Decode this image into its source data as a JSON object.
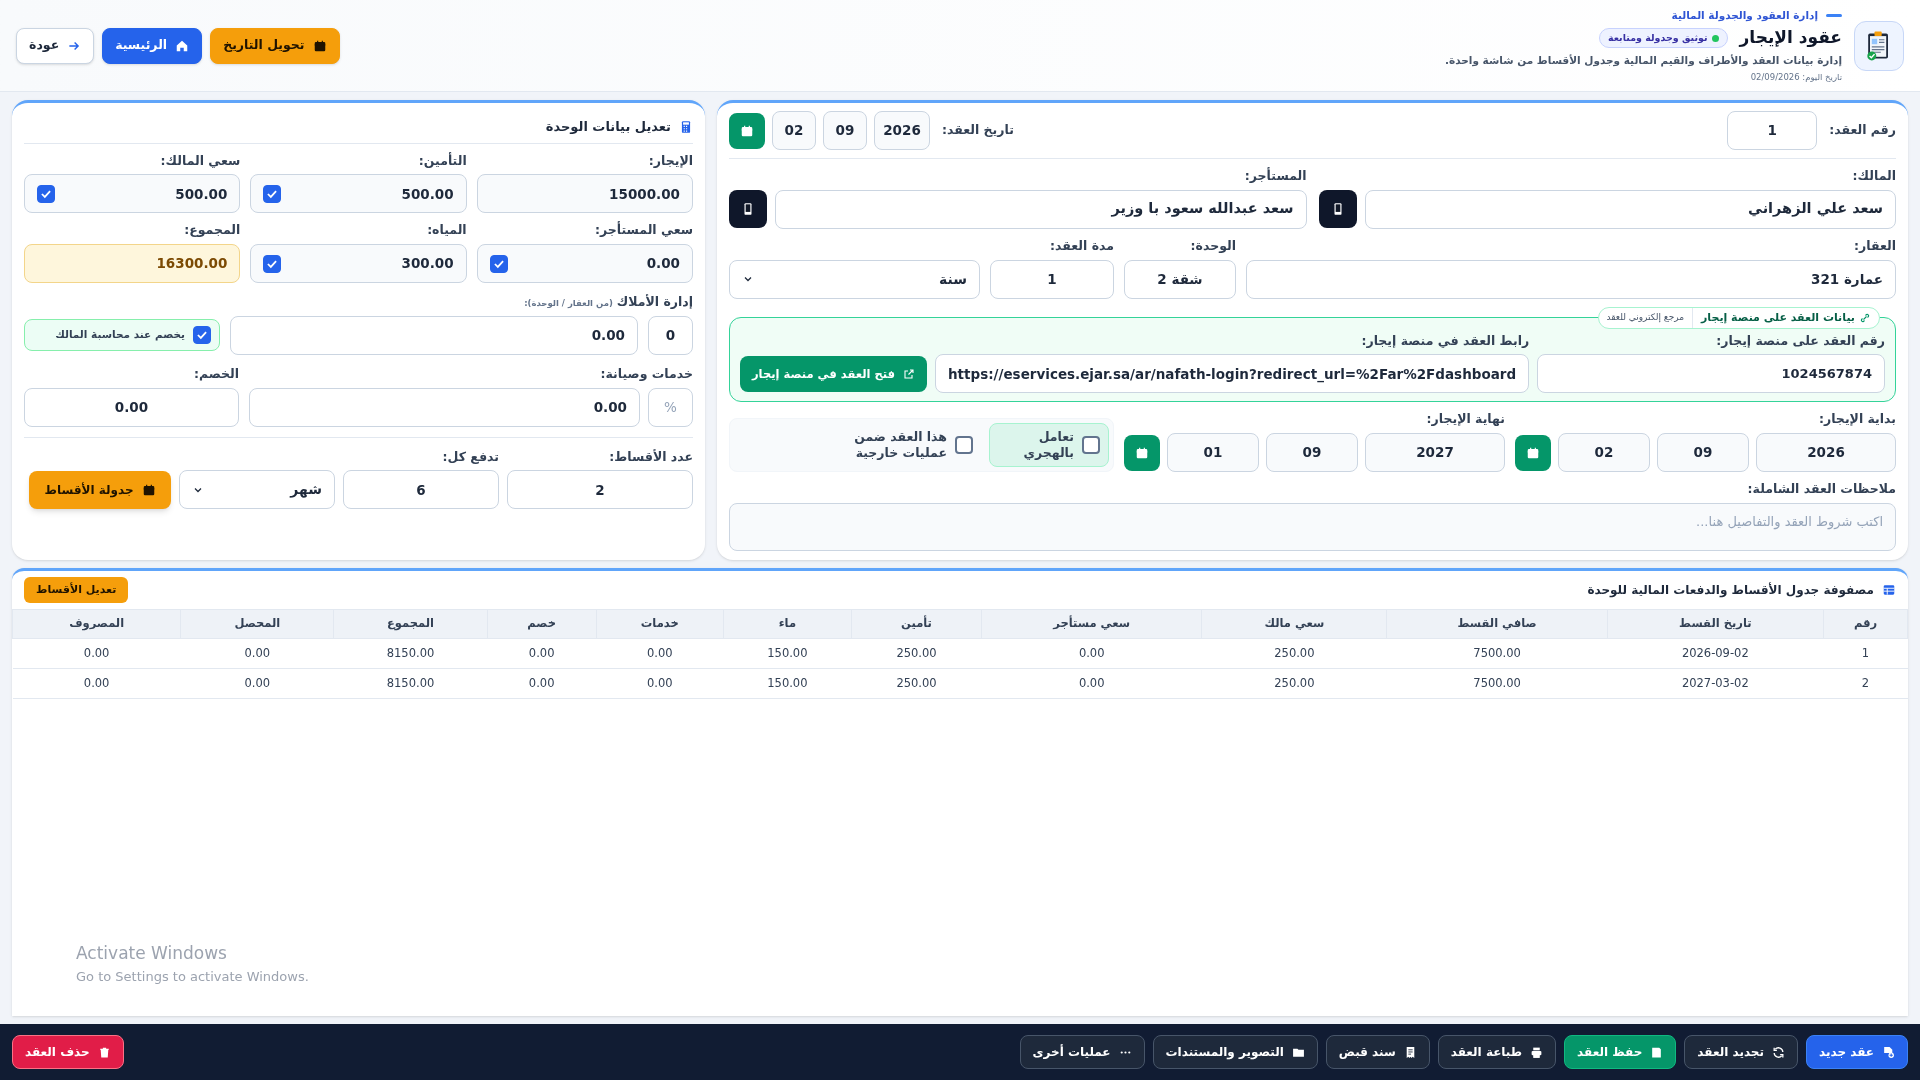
{
  "header": {
    "breadcrumb": "إدارة العقود والجدولة المالية",
    "title": "عقود الإيجار",
    "badge": "توثيق وجدولة ومتابعة",
    "subtitle": "إدارة بيانات العقد والأطراف والقيم المالية وجدول الأقساط من شاشة واحدة.",
    "today": "تاريخ اليوم: 02/09/2026",
    "buttons": [
      {
        "label": "تحويل التاريخ",
        "kind": "convert"
      },
      {
        "label": "الرئيسية",
        "kind": "home"
      },
      {
        "label": "عودة",
        "kind": "back"
      }
    ]
  },
  "contract": {
    "number": {
      "label": "رقم العقد:",
      "value": "1"
    },
    "date": {
      "label": "تاريخ العقد:",
      "year": "2026",
      "month": "09",
      "day": "02"
    },
    "owner": {
      "label": "المالك:",
      "value": "سعد علي الزهراني"
    },
    "tenant": {
      "label": "المستأجر:",
      "value": "سعد عبدالله سعود با وزير"
    },
    "property": {
      "label": "العقار:",
      "value": "عمارة 321"
    },
    "unit": {
      "label": "الوحدة:",
      "value": "شقة 2"
    },
    "duration": {
      "label": "مدة العقد:",
      "value": "1",
      "period": "سنة"
    },
    "ejar": {
      "title": "بيانات العقد على منصة إيجار",
      "tag": "مرجع إلكتروني للعقد",
      "number_label": "رقم العقد على منصة إيجار:",
      "number": "1024567874",
      "link_label": "رابط العقد في منصة إيجار:",
      "link": "https://eservices.ejar.sa/ar/nafath-login?redirect_url=%2Far%2Fdashboard",
      "open_button": "فتح العقد في منصة إيجار"
    },
    "lease_start": {
      "label": "بداية الإيجار:",
      "year": "2026",
      "month": "09",
      "day": "02"
    },
    "lease_end": {
      "label": "نهاية الإيجار:",
      "year": "2027",
      "month": "09",
      "day": "01"
    },
    "hijri": {
      "label": "تعامل بالهجري",
      "checked": false
    },
    "external": {
      "label": "هذا العقد ضمن عمليات خارجية",
      "checked": false
    },
    "notes": {
      "label": "ملاحظات العقد الشاملة:",
      "placeholder": "اكتب شروط العقد والتفاصيل هنا..."
    }
  },
  "unit_panel": {
    "title": "تعديل بيانات الوحدة",
    "fields": [
      {
        "label": "الإيجار:",
        "value": "15000.00",
        "kind": "plain"
      },
      {
        "label": "التأمين:",
        "value": "500.00",
        "kind": "check",
        "checked": true
      },
      {
        "label": "سعي المالك:",
        "value": "500.00",
        "kind": "check",
        "checked": true
      },
      {
        "label": "سعي المستأجر:",
        "value": "0.00",
        "kind": "check",
        "checked": true
      },
      {
        "label": "المياه:",
        "value": "300.00",
        "kind": "check",
        "checked": true
      },
      {
        "label": "المجموع:",
        "value": "16300.00",
        "kind": "total"
      }
    ],
    "management": {
      "label": "إدارة الأملاك",
      "note": "(من العقار / الوحدة):",
      "count": "0",
      "value": "0.00",
      "deduct": {
        "label": "يخصم عند محاسبة المالك",
        "checked": true
      }
    },
    "services": {
      "label": "خدمات وصيانة:",
      "percent": "%",
      "value": "0.00"
    },
    "discount": {
      "label": "الخصم:",
      "value": "0.00"
    },
    "installments": {
      "label": "عدد الأقساط:",
      "value": "2"
    },
    "every": {
      "label": "تدفع كل:",
      "value": "6",
      "period": "شهر"
    },
    "schedule_button": "جدولة الأقساط"
  },
  "table": {
    "title": "مصفوفة جدول الأقساط والدفعات المالية للوحدة",
    "edit_button": "تعديل الأقساط",
    "columns": [
      "رقم",
      "تاريخ القسط",
      "صافي القسط",
      "سعي مالك",
      "سعي مستأجر",
      "تأمين",
      "ماء",
      "خدمات",
      "خصم",
      "المجموع",
      "المحصل",
      "المصروف"
    ],
    "rows": [
      [
        "1",
        "2026-09-02",
        "7500.00",
        "250.00",
        "0.00",
        "250.00",
        "150.00",
        "0.00",
        "0.00",
        "8150.00",
        "0.00",
        "0.00"
      ],
      [
        "2",
        "2027-03-02",
        "7500.00",
        "250.00",
        "0.00",
        "250.00",
        "150.00",
        "0.00",
        "0.00",
        "8150.00",
        "0.00",
        "0.00"
      ]
    ]
  },
  "watermark": {
    "title": "Activate Windows",
    "text": "Go to Settings to activate Windows."
  },
  "footer": [
    {
      "label": "عقد جديد",
      "kind": "new"
    },
    {
      "label": "تجديد العقد",
      "kind": "renew"
    },
    {
      "label": "حفظ العقد",
      "kind": "save"
    },
    {
      "label": "طباعة العقد",
      "kind": "print"
    },
    {
      "label": "سند قبض",
      "kind": "receipt"
    },
    {
      "label": "التصوير والمستندات",
      "kind": "docs"
    },
    {
      "label": "عمليات أخرى",
      "kind": "more"
    },
    {
      "label": "حذف العقد",
      "kind": "delete"
    }
  ]
}
